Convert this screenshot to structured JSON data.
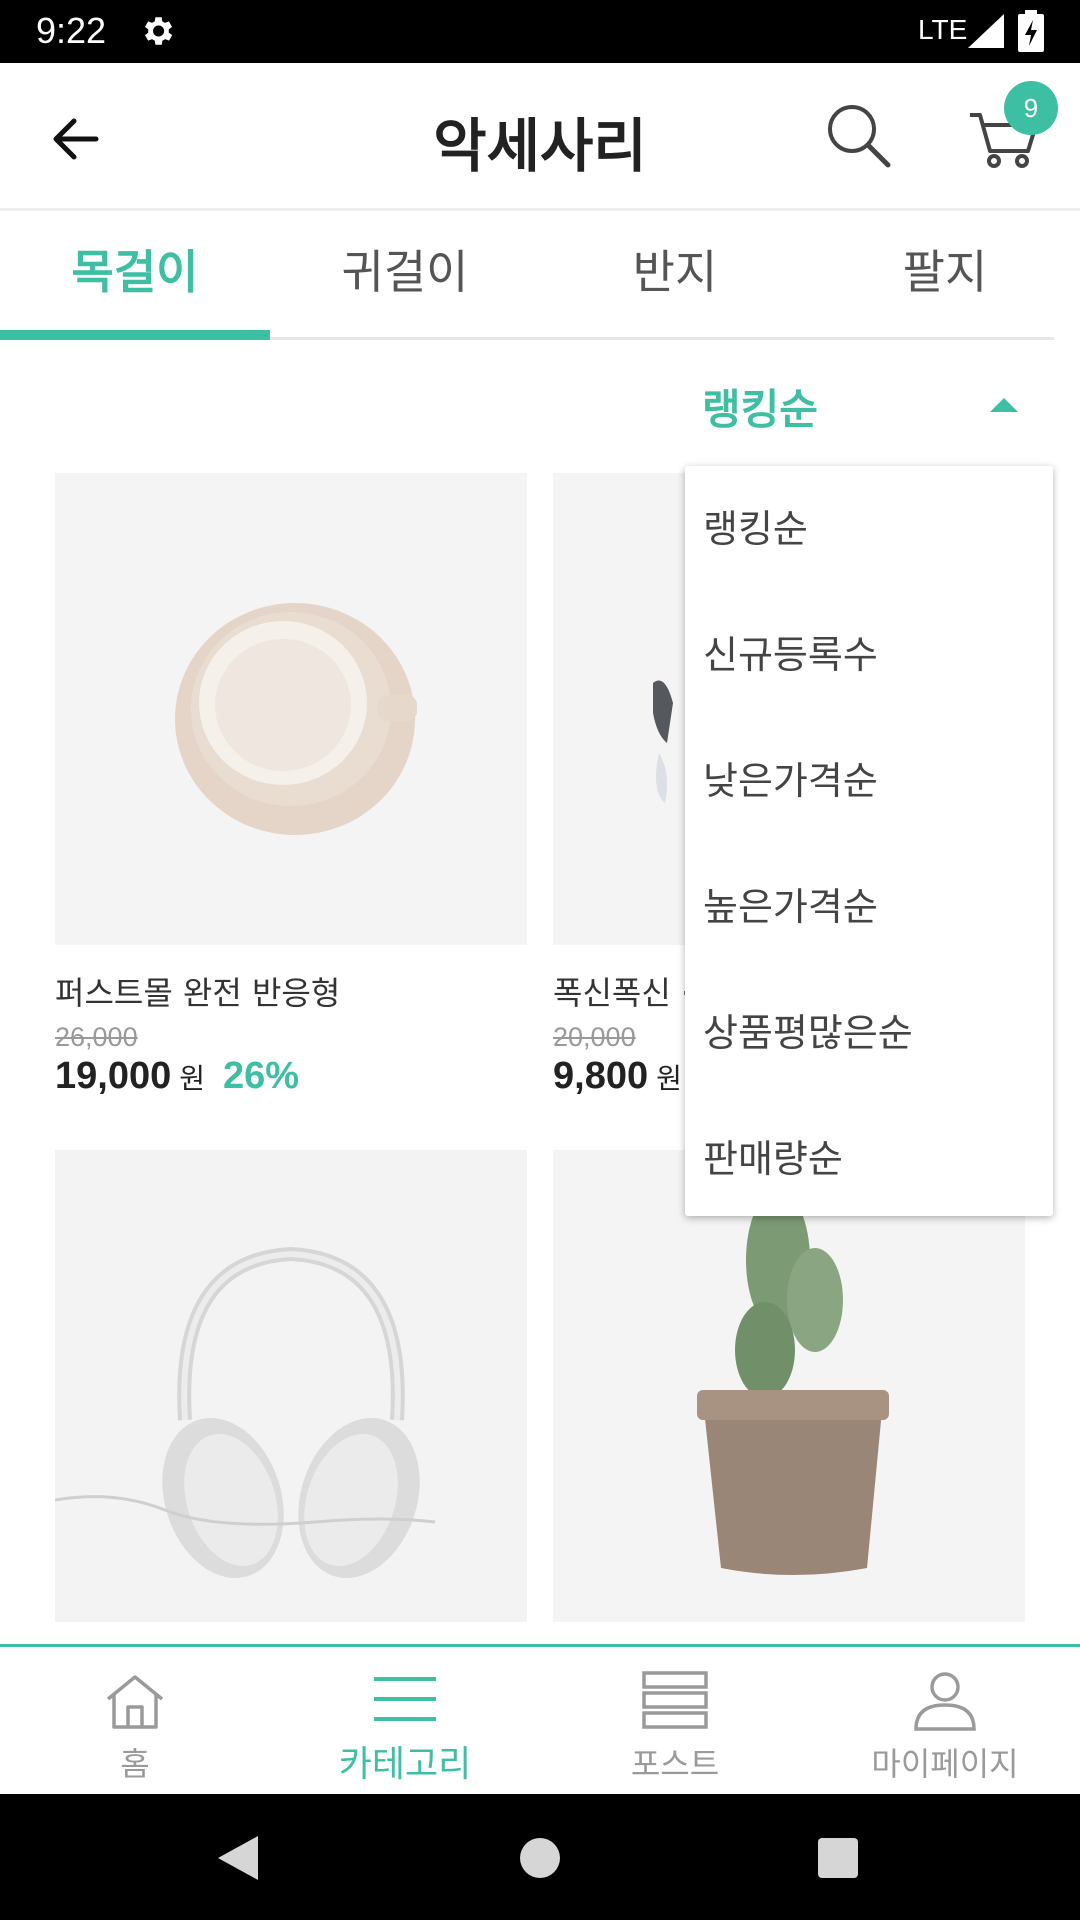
{
  "status_bar": {
    "time": "9:22",
    "network": "LTE"
  },
  "header": {
    "title": "악세사리",
    "cart_count": "9"
  },
  "tabs": [
    {
      "label": "목걸이",
      "active": true
    },
    {
      "label": "귀걸이",
      "active": false
    },
    {
      "label": "반지",
      "active": false
    },
    {
      "label": "팔지",
      "active": false
    }
  ],
  "sort": {
    "selected": "랭킹순",
    "options": [
      "랭킹순",
      "신규등록수",
      "낮은가격순",
      "높은가격순",
      "상품평많은순",
      "판매량순"
    ]
  },
  "products": [
    {
      "name": "퍼스트몰 완전 반응형",
      "original_price": "26,000",
      "price": "19,000",
      "currency": "원",
      "discount": "26%",
      "image": "coffee-cup"
    },
    {
      "name": "폭신폭신 ·",
      "original_price": "20,000",
      "price": "9,800",
      "currency": "원",
      "discount": "",
      "image": "sunglasses"
    },
    {
      "name": "",
      "original_price": "",
      "price": "",
      "currency": "",
      "discount": "",
      "image": "headphones"
    },
    {
      "name": "",
      "original_price": "",
      "price": "",
      "currency": "",
      "discount": "",
      "image": "cactus"
    }
  ],
  "bottom_nav": [
    {
      "label": "홈",
      "icon": "home-icon",
      "active": false
    },
    {
      "label": "카테고리",
      "icon": "menu-icon",
      "active": true
    },
    {
      "label": "포스트",
      "icon": "posts-icon",
      "active": false
    },
    {
      "label": "마이페이지",
      "icon": "user-icon",
      "active": false
    }
  ],
  "colors": {
    "accent": "#3cbfa3",
    "text": "#222222",
    "muted": "#9a9a9a"
  }
}
